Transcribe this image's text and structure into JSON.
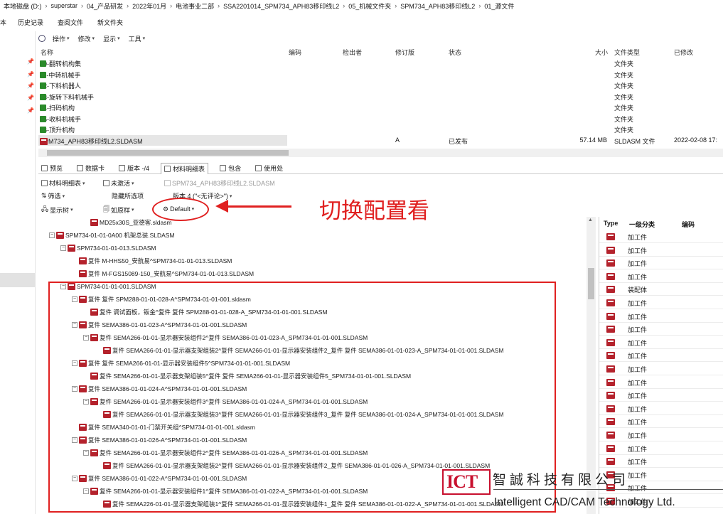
{
  "breadcrumb": [
    "本地磁盘 (D:)",
    "superstar",
    "04_产品研发",
    "2022年01月",
    "电池事业二部",
    "SSA2201014_SPM734_APH83移印线L2",
    "05_机械文件夹",
    "SPM734_APH83移印线L2",
    "01_源文件"
  ],
  "menubar": [
    "本",
    "历史记录",
    "查阅文件",
    "新文件夹"
  ],
  "toolbar": [
    "操作",
    "修改",
    "显示",
    "工具"
  ],
  "file_columns": {
    "name": "名称",
    "code": "编码",
    "checkout": "检出者",
    "revision": "修订版",
    "status": "状态",
    "size": "大小",
    "type": "文件类型",
    "modified": "已修改"
  },
  "files": [
    {
      "name": "10-翻转机构集",
      "type": "文件夹"
    },
    {
      "name": "11-中转机械手",
      "type": "文件夹"
    },
    {
      "name": "12-下料机器人",
      "type": "文件夹"
    },
    {
      "name": "13-旋转下料机械手",
      "type": "文件夹"
    },
    {
      "name": "14-扫码机构",
      "type": "文件夹"
    },
    {
      "name": "15-收料机械手",
      "type": "文件夹"
    },
    {
      "name": "16-顶升机构",
      "type": "文件夹"
    },
    {
      "name": "SPM734_APH83移印线L2.SLDASM",
      "revision": "A",
      "status": "已发布",
      "size": "57.14 MB",
      "type": "SLDASM 文件",
      "modified": "2022-02-08 17:"
    }
  ],
  "tabs": [
    "预览",
    "数据卡",
    "版本 -/4",
    "材料明细表",
    "包含",
    "使用处"
  ],
  "bom_toolbar": {
    "bom_dropdown": "材料明细表",
    "unactivated": "未激活",
    "file_label": "SPM734_APH83移印线L2.SLDASM",
    "filter": "筛选",
    "hidden_options": "隐藏所选项",
    "version": "版本 4 (\"<无评论>\")",
    "show_tree": "显示树",
    "as_built": "如原样",
    "config": "Default"
  },
  "annotation": "切换配置看",
  "tree": [
    {
      "level": 3,
      "box": "",
      "text": "MD25x30S_亚德客.sldasm"
    },
    {
      "level": 0,
      "box": "−",
      "text": "SPM734-01-01-0A00 机架总装.SLDASM"
    },
    {
      "level": 1,
      "box": "−",
      "text": "SPM734-01-01-013.SLDASM"
    },
    {
      "level": 2,
      "box": "",
      "text": "复件 M-HHS50_安航易^SPM734-01-01-013.SLDASM"
    },
    {
      "level": 2,
      "box": "",
      "text": "复件 M-FGS15089-150_安航易^SPM734-01-01-013.SLDASM"
    },
    {
      "level": 1,
      "box": "−",
      "text": "SPM734-01-01-001.SLDASM"
    },
    {
      "level": 2,
      "box": "−",
      "text": "复件 复件 SPM288-01-01-028-A^SPM734-01-01-001.sldasm"
    },
    {
      "level": 3,
      "box": "",
      "text": "复件 调试面板，钣金^复件 复件 SPM288-01-01-028-A_SPM734-01-01-001.SLDASM"
    },
    {
      "level": 2,
      "box": "−",
      "text": "复件 SEMA386-01-01-023-A^SPM734-01-01-001.SLDASM"
    },
    {
      "level": 3,
      "box": "−",
      "text": "复件 SEMA266-01-01-显示器安装组件2^复件 SEMA386-01-01-023-A_SPM734-01-01-001.SLDASM"
    },
    {
      "level": 4,
      "box": "",
      "text": "复件 SEMA266-01-01-显示器支架组装2^复件 SEMA266-01-01-显示器安装组件2_复件 复件 SEMA386-01-01-023-A_SPM734-01-01-001.SLDASM"
    },
    {
      "level": 2,
      "box": "−",
      "text": "复件 复件 SEMA266-01-01-显示器安装组件5^SPM734-01-01-001.SLDASM"
    },
    {
      "level": 3,
      "box": "",
      "text": "复件 SEMA266-01-01-显示器支架组装5^复件 复件 SEMA266-01-01-显示器安装组件5_SPM734-01-01-001.SLDASM"
    },
    {
      "level": 2,
      "box": "−",
      "text": "复件 SEMA386-01-01-024-A^SPM734-01-01-001.SLDASM"
    },
    {
      "level": 3,
      "box": "−",
      "text": "复件 SEMA266-01-01-显示器安装组件3^复件 SEMA386-01-01-024-A_SPM734-01-01-001.SLDASM"
    },
    {
      "level": 4,
      "box": "",
      "text": "复件 SEMA266-01-01-显示器支架组装3^复件 SEMA266-01-01-显示器安装组件3_复件 复件 SEMA386-01-01-024-A_SPM734-01-01-001.SLDASM"
    },
    {
      "level": 2,
      "box": "",
      "text": "复件 SEMA340-01-01-门禁开关组^SPM734-01-01-001.sldasm"
    },
    {
      "level": 2,
      "box": "−",
      "text": "复件 SEMA386-01-01-026-A^SPM734-01-01-001.SLDASM"
    },
    {
      "level": 3,
      "box": "−",
      "text": "复件 SEMA266-01-01-显示器安装组件2^复件 SEMA386-01-01-026-A_SPM734-01-01-001.SLDASM"
    },
    {
      "level": 4,
      "box": "",
      "text": "复件 SEMA266-01-01-显示器支架组装2^复件 SEMA266-01-01-显示器安装组件2_复件 SEMA386-01-01-026-A_SPM734-01-01-001.SLDASM"
    },
    {
      "level": 2,
      "box": "−",
      "text": "复件 SEMA386-01-01-022-A^SPM734-01-01-001.SLDASM"
    },
    {
      "level": 3,
      "box": "−",
      "text": "复件 SEMA266-01-01-显示器安装组件1^复件 SEMA386-01-01-022-A_SPM734-01-01-001.SLDASM"
    },
    {
      "level": 4,
      "box": "",
      "text": "复件 SEMA226-01-01-显示器支架组装1^复件 SEMA266-01-01-显示器安装组件1_复件 复件 SEMA386-01-01-022-A_SPM734-01-01-001.SLDASM"
    }
  ],
  "right_panel": {
    "headers": [
      "Type",
      "一级分类",
      "编码"
    ],
    "rows": [
      "加工件",
      "加工件",
      "加工件",
      "加工件",
      "装配体",
      "加工件",
      "加工件",
      "加工件",
      "加工件",
      "加工件",
      "加工件",
      "加工件",
      "加工件",
      "加工件",
      "加工件",
      "加工件",
      "加工件",
      "加工件",
      "加工件",
      "加工件",
      "加工件"
    ]
  },
  "logo": {
    "mark": "ICT",
    "cn": "智誠科技有限公司",
    "en": "Intelligent CAD/CAM Technology Ltd."
  }
}
